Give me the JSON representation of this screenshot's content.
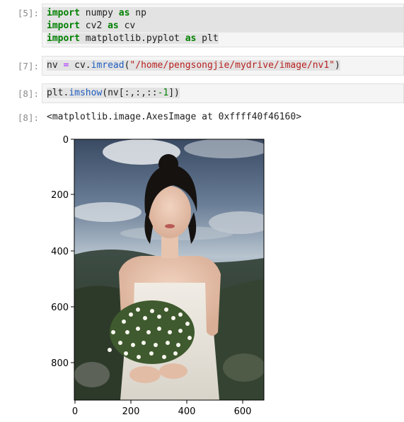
{
  "cells": [
    {
      "prompt": "[5]:",
      "lines": [
        {
          "kw1": "import",
          "t1": " numpy ",
          "kw2": "as",
          "t2": " np"
        },
        {
          "kw1": "import",
          "t1": " cv2 ",
          "kw2": "as",
          "t2": " cv"
        },
        {
          "kw1": "import",
          "t1": " matplotlib.pyplot ",
          "kw2": "as",
          "t2": " plt"
        }
      ]
    },
    {
      "prompt": "[7]:",
      "var": "nv",
      "op": " = ",
      "obj": "cv.",
      "fn": "imread",
      "open": "(",
      "str": "\"/home/pengsongjie/mydrive/image/nv1\"",
      "close": ")"
    },
    {
      "prompt": "[8]:",
      "obj": "plt.",
      "fn": "imshow",
      "args_a": "(nv[:,:,::",
      "neg": "-1",
      "args_b": "])"
    }
  ],
  "output": {
    "prompt": "[8]:",
    "text": "<matplotlib.image.AxesImage at 0xffff40f46160>"
  },
  "plot": {
    "y_ticks": [
      "0",
      "200",
      "400",
      "600",
      "800"
    ],
    "x_ticks": [
      "0",
      "200",
      "400",
      "600"
    ],
    "image_alt": "photo of a woman in a white dress holding a bouquet of white flowers against a cloudy sky and hills"
  }
}
